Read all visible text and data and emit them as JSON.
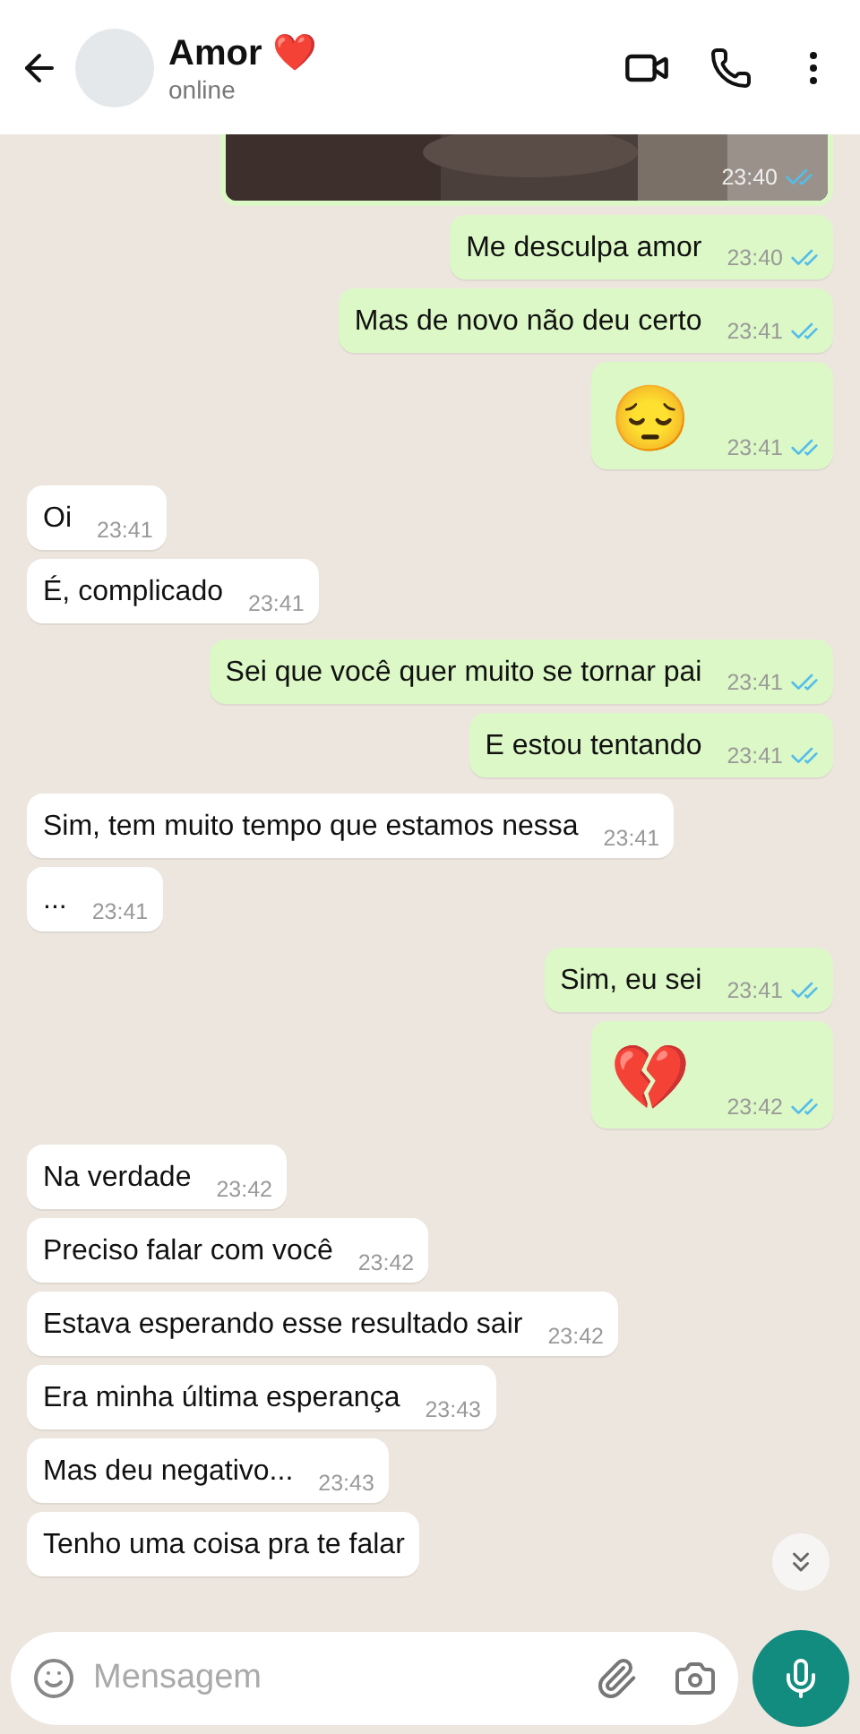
{
  "header": {
    "title": "Amor ❤️",
    "status": "online"
  },
  "messages": [
    {
      "outgoing": true,
      "time": "23:40",
      "read": true
    },
    {
      "kind": "text",
      "outgoing": true,
      "text": "Me desculpa amor",
      "time": "23:40",
      "read": true
    },
    {
      "kind": "text",
      "outgoing": true,
      "text": "Mas de novo não deu certo",
      "time": "23:41",
      "read": true
    },
    {
      "kind": "emoji",
      "outgoing": true,
      "text": "😔",
      "time": "23:41",
      "read": true
    },
    {
      "kind": "text",
      "outgoing": false,
      "text": "Oi",
      "time": "23:41"
    },
    {
      "kind": "text",
      "outgoing": false,
      "text": "É, complicado",
      "time": "23:41"
    },
    {
      "kind": "text",
      "outgoing": true,
      "text": "Sei que você quer muito se tornar pai",
      "time": "23:41",
      "read": true
    },
    {
      "kind": "text",
      "outgoing": true,
      "text": "E estou tentando",
      "time": "23:41",
      "read": true
    },
    {
      "kind": "text",
      "outgoing": false,
      "text": "Sim, tem muito tempo que estamos nessa",
      "time": "23:41"
    },
    {
      "kind": "text",
      "outgoing": false,
      "text": "...",
      "time": "23:41"
    },
    {
      "kind": "text",
      "outgoing": true,
      "text": "Sim, eu sei",
      "time": "23:41",
      "read": true
    },
    {
      "kind": "emoji",
      "outgoing": true,
      "text": "💔",
      "time": "23:42",
      "read": true
    },
    {
      "kind": "text",
      "outgoing": false,
      "text": "Na verdade",
      "time": "23:42"
    },
    {
      "kind": "text",
      "outgoing": false,
      "text": "Preciso falar com você",
      "time": "23:42"
    },
    {
      "kind": "text",
      "outgoing": false,
      "text": "Estava esperando esse resultado sair",
      "time": "23:42"
    },
    {
      "kind": "text",
      "outgoing": false,
      "text": "Era minha última esperança",
      "time": "23:43"
    },
    {
      "kind": "text",
      "outgoing": false,
      "text": "Mas deu negativo...",
      "time": "23:43"
    },
    {
      "kind": "text",
      "outgoing": false,
      "text": "Tenho uma coisa pra te falar"
    }
  ],
  "composer": {
    "placeholder": "Mensagem"
  }
}
